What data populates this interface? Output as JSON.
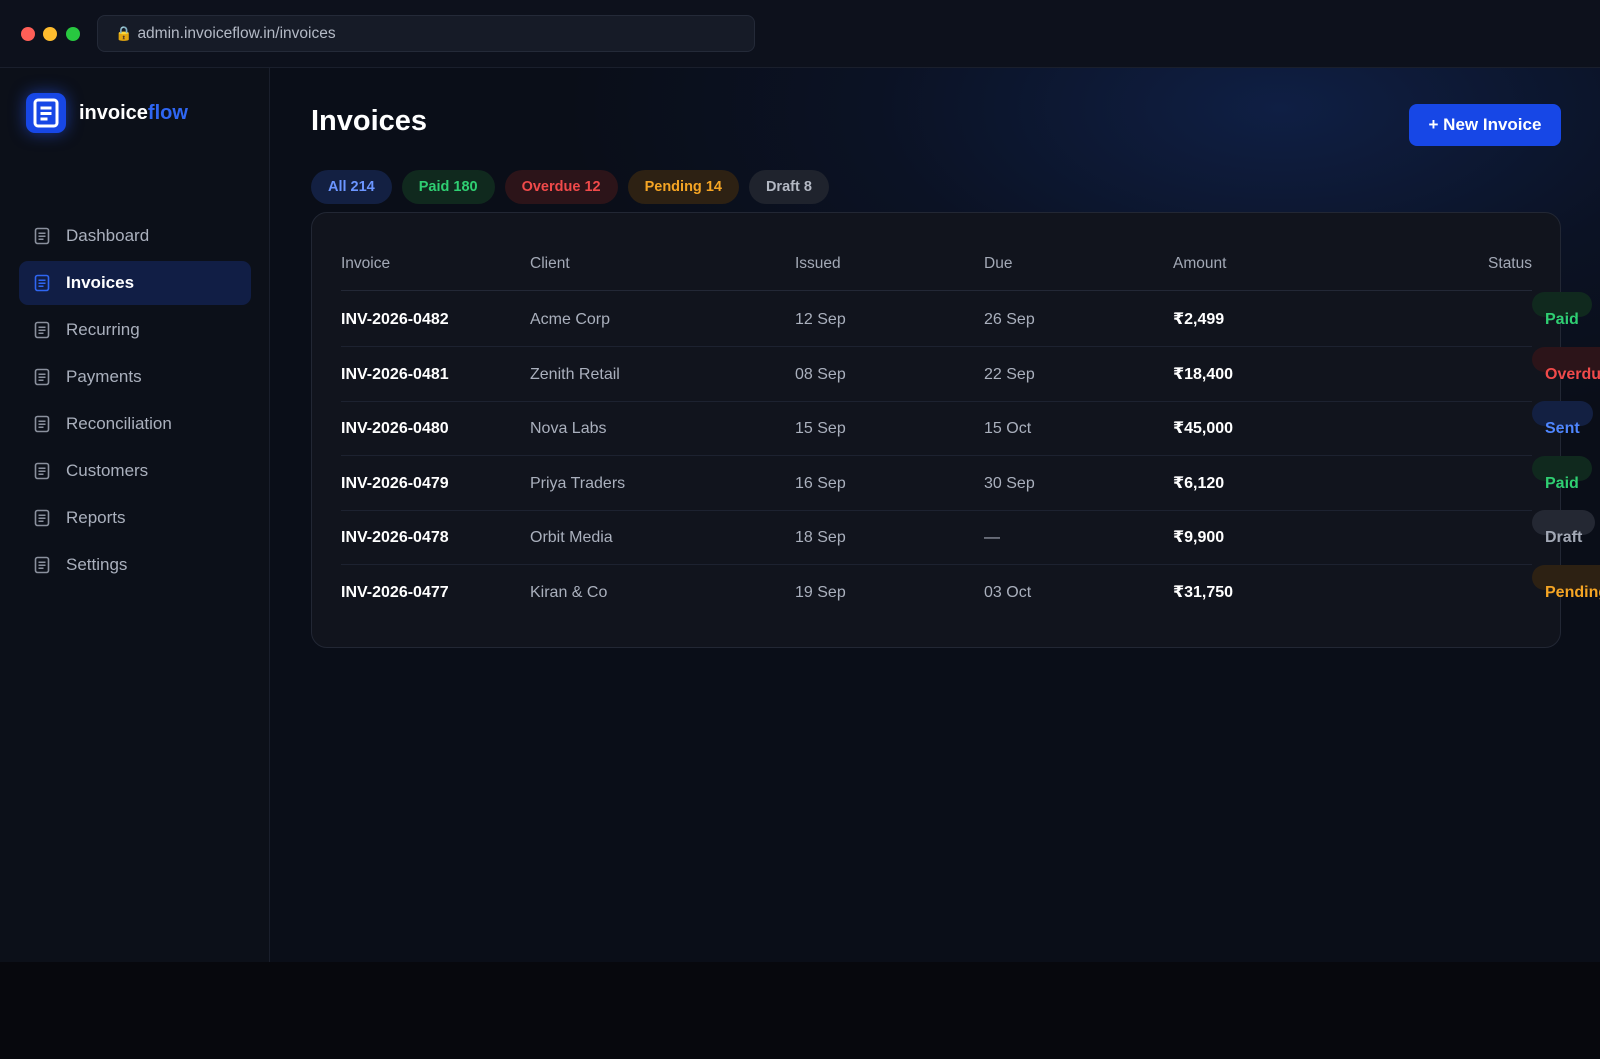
{
  "browser": {
    "url": "admin.invoiceflow.in/invoices"
  },
  "brand": {
    "name_main": "invoice",
    "name_accent": "flow",
    "accent_color": "#2f66f2"
  },
  "sidebar": {
    "items": [
      {
        "label": "Dashboard",
        "icon": "document-icon",
        "active": false
      },
      {
        "label": "Invoices",
        "icon": "document-icon",
        "active": true
      },
      {
        "label": "Recurring",
        "icon": "document-icon",
        "active": false
      },
      {
        "label": "Payments",
        "icon": "document-icon",
        "active": false
      },
      {
        "label": "Reconciliation",
        "icon": "document-icon",
        "active": false
      },
      {
        "label": "Customers",
        "icon": "document-icon",
        "active": false
      },
      {
        "label": "Reports",
        "icon": "document-icon",
        "active": false
      },
      {
        "label": "Settings",
        "icon": "document-icon",
        "active": false
      }
    ]
  },
  "header": {
    "title": "Invoices",
    "new_button": "+ New Invoice",
    "button_color": "#1747e6"
  },
  "filters": [
    {
      "label": "All 214",
      "key": "all"
    },
    {
      "label": "Paid 180",
      "key": "paid"
    },
    {
      "label": "Overdue 12",
      "key": "overdue"
    },
    {
      "label": "Pending 14",
      "key": "pending"
    },
    {
      "label": "Draft 8",
      "key": "draft"
    }
  ],
  "table": {
    "columns": [
      "Invoice",
      "Client",
      "Issued",
      "Due",
      "Amount",
      "Status"
    ],
    "rows": [
      {
        "invoice": "INV-2026-0482",
        "client": "Acme Corp",
        "issued": "12 Sep",
        "due": "26 Sep",
        "amount": "₹2,499",
        "status": "Paid",
        "status_key": "paid"
      },
      {
        "invoice": "INV-2026-0481",
        "client": "Zenith Retail",
        "issued": "08 Sep",
        "due": "22 Sep",
        "amount": "₹18,400",
        "status": "Overdue",
        "status_key": "overdue"
      },
      {
        "invoice": "INV-2026-0480",
        "client": "Nova Labs",
        "issued": "15 Sep",
        "due": "15 Oct",
        "amount": "₹45,000",
        "status": "Sent",
        "status_key": "sent"
      },
      {
        "invoice": "INV-2026-0479",
        "client": "Priya Traders",
        "issued": "16 Sep",
        "due": "30 Sep",
        "amount": "₹6,120",
        "status": "Paid",
        "status_key": "paid"
      },
      {
        "invoice": "INV-2026-0478",
        "client": "Orbit Media",
        "issued": "18 Sep",
        "due": "—",
        "amount": "₹9,900",
        "status": "Draft",
        "status_key": "draft"
      },
      {
        "invoice": "INV-2026-0477",
        "client": "Kiran & Co",
        "issued": "19 Sep",
        "due": "03 Oct",
        "amount": "₹31,750",
        "status": "Pending",
        "status_key": "pending"
      }
    ]
  },
  "status_colors": {
    "paid": "#2fcf72",
    "overdue": "#f04a4a",
    "sent": "#4f86ff",
    "draft": "#a3a9b6",
    "pending": "#f5a524"
  }
}
